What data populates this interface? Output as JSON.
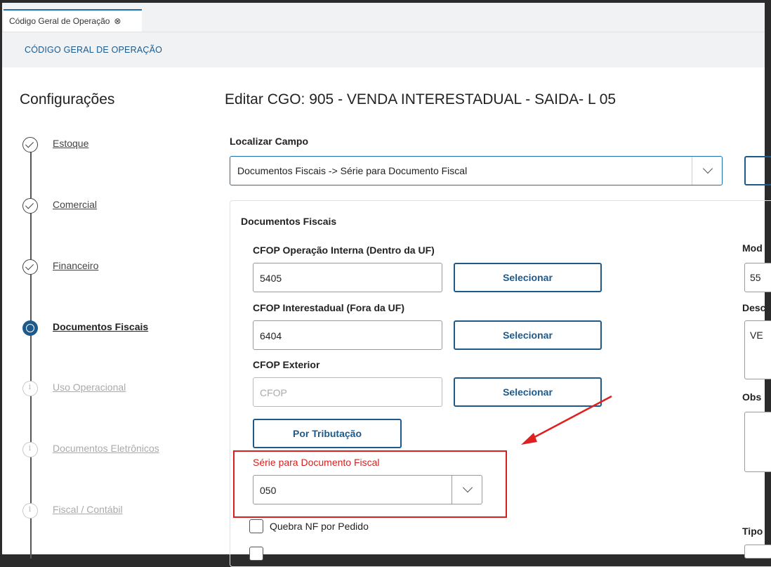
{
  "tab": {
    "label": "Código Geral de Operação",
    "close_glyph": "⊗"
  },
  "page_header": "CÓDIGO GERAL DE OPERAÇÃO",
  "sidebar": {
    "title": "Configurações",
    "steps": [
      {
        "label": "Estoque",
        "state": "done"
      },
      {
        "label": "Comercial",
        "state": "done"
      },
      {
        "label": "Financeiro",
        "state": "done"
      },
      {
        "label": "Documentos Fiscais",
        "state": "active"
      },
      {
        "label": "Uso Operacional",
        "state": "todo"
      },
      {
        "label": "Documentos Eletrônicos",
        "state": "todo"
      },
      {
        "label": "Fiscal / Contábil",
        "state": "todo"
      }
    ]
  },
  "main": {
    "title": "Editar CGO: 905 - VENDA INTERESTADUAL - SAIDA- L 05",
    "locate": {
      "label": "Localizar Campo",
      "value": "Documentos Fiscais -> Série para Documento Fiscal"
    },
    "section_title": "Documentos Fiscais",
    "fields": {
      "cfop_interna": {
        "label": "CFOP Operação Interna (Dentro da UF)",
        "value": "5405",
        "button": "Selecionar"
      },
      "cfop_inter": {
        "label": "CFOP Interestadual (Fora da UF)",
        "value": "6404",
        "button": "Selecionar"
      },
      "cfop_ext": {
        "label": "CFOP Exterior",
        "placeholder": "CFOP",
        "button": "Selecionar"
      }
    },
    "por_tributacao": "Por Tributação",
    "serie": {
      "label": "Série para Documento Fiscal",
      "value": "050"
    },
    "quebra_nf": "Quebra NF por Pedido",
    "right_column": {
      "mod_label": "Mod",
      "mod_value": "55",
      "desc_label": "Desc",
      "desc_value": "VE",
      "obs_label": "Obs",
      "tipo_label": "Tipo"
    }
  },
  "colors": {
    "primary": "#1d5a8c",
    "highlight": "#d81f1f"
  }
}
